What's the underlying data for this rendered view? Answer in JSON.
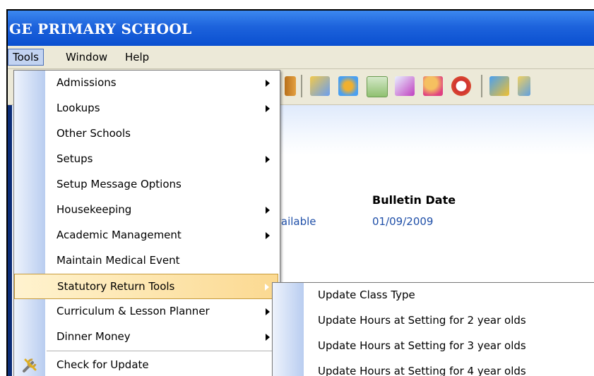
{
  "window": {
    "title": "GE PRIMARY SCHOOL"
  },
  "menubar": [
    {
      "id": "tools",
      "label": "Tools"
    },
    {
      "id": "window",
      "label": "Window"
    },
    {
      "id": "help",
      "label": "Help"
    }
  ],
  "content": {
    "bulletin_date_header": "Bulletin Date",
    "status_text": "vailable",
    "bulletin_date_value": "01/09/2009"
  },
  "tools_menu": [
    {
      "label": "Admissions",
      "submenu": true
    },
    {
      "label": "Lookups",
      "submenu": true
    },
    {
      "label": "Other Schools",
      "submenu": false
    },
    {
      "label": "Setups",
      "submenu": true
    },
    {
      "label": "Setup Message Options",
      "submenu": false
    },
    {
      "label": "Housekeeping",
      "submenu": true
    },
    {
      "label": "Academic Management",
      "submenu": true
    },
    {
      "label": "Maintain Medical Event",
      "submenu": false
    },
    {
      "label": "Statutory Return Tools",
      "submenu": true,
      "highlighted": true
    },
    {
      "label": "Curriculum & Lesson Planner",
      "submenu": true
    },
    {
      "label": "Dinner Money",
      "submenu": true
    },
    {
      "label": "Check for Update",
      "submenu": false,
      "icon": "tools-wrench-icon"
    }
  ],
  "statutory_submenu": [
    {
      "label": "Update Class Type"
    },
    {
      "label": "Update Hours at Setting for 2 year olds"
    },
    {
      "label": "Update Hours at Setting for 3 year olds"
    },
    {
      "label": "Update Hours at Setting for 4 year olds"
    }
  ],
  "toolbar_icons": [
    "book-icon",
    "edit-pencil-icon",
    "settings-gear-icon",
    "notebook-icon",
    "document-edit-icon",
    "users-icon",
    "clock-icon",
    "refresh-icon",
    "folder-icon"
  ],
  "colors": {
    "titlebar": "#0a4fd0",
    "highlight": "#fbd991",
    "link": "#1f4fa8"
  }
}
